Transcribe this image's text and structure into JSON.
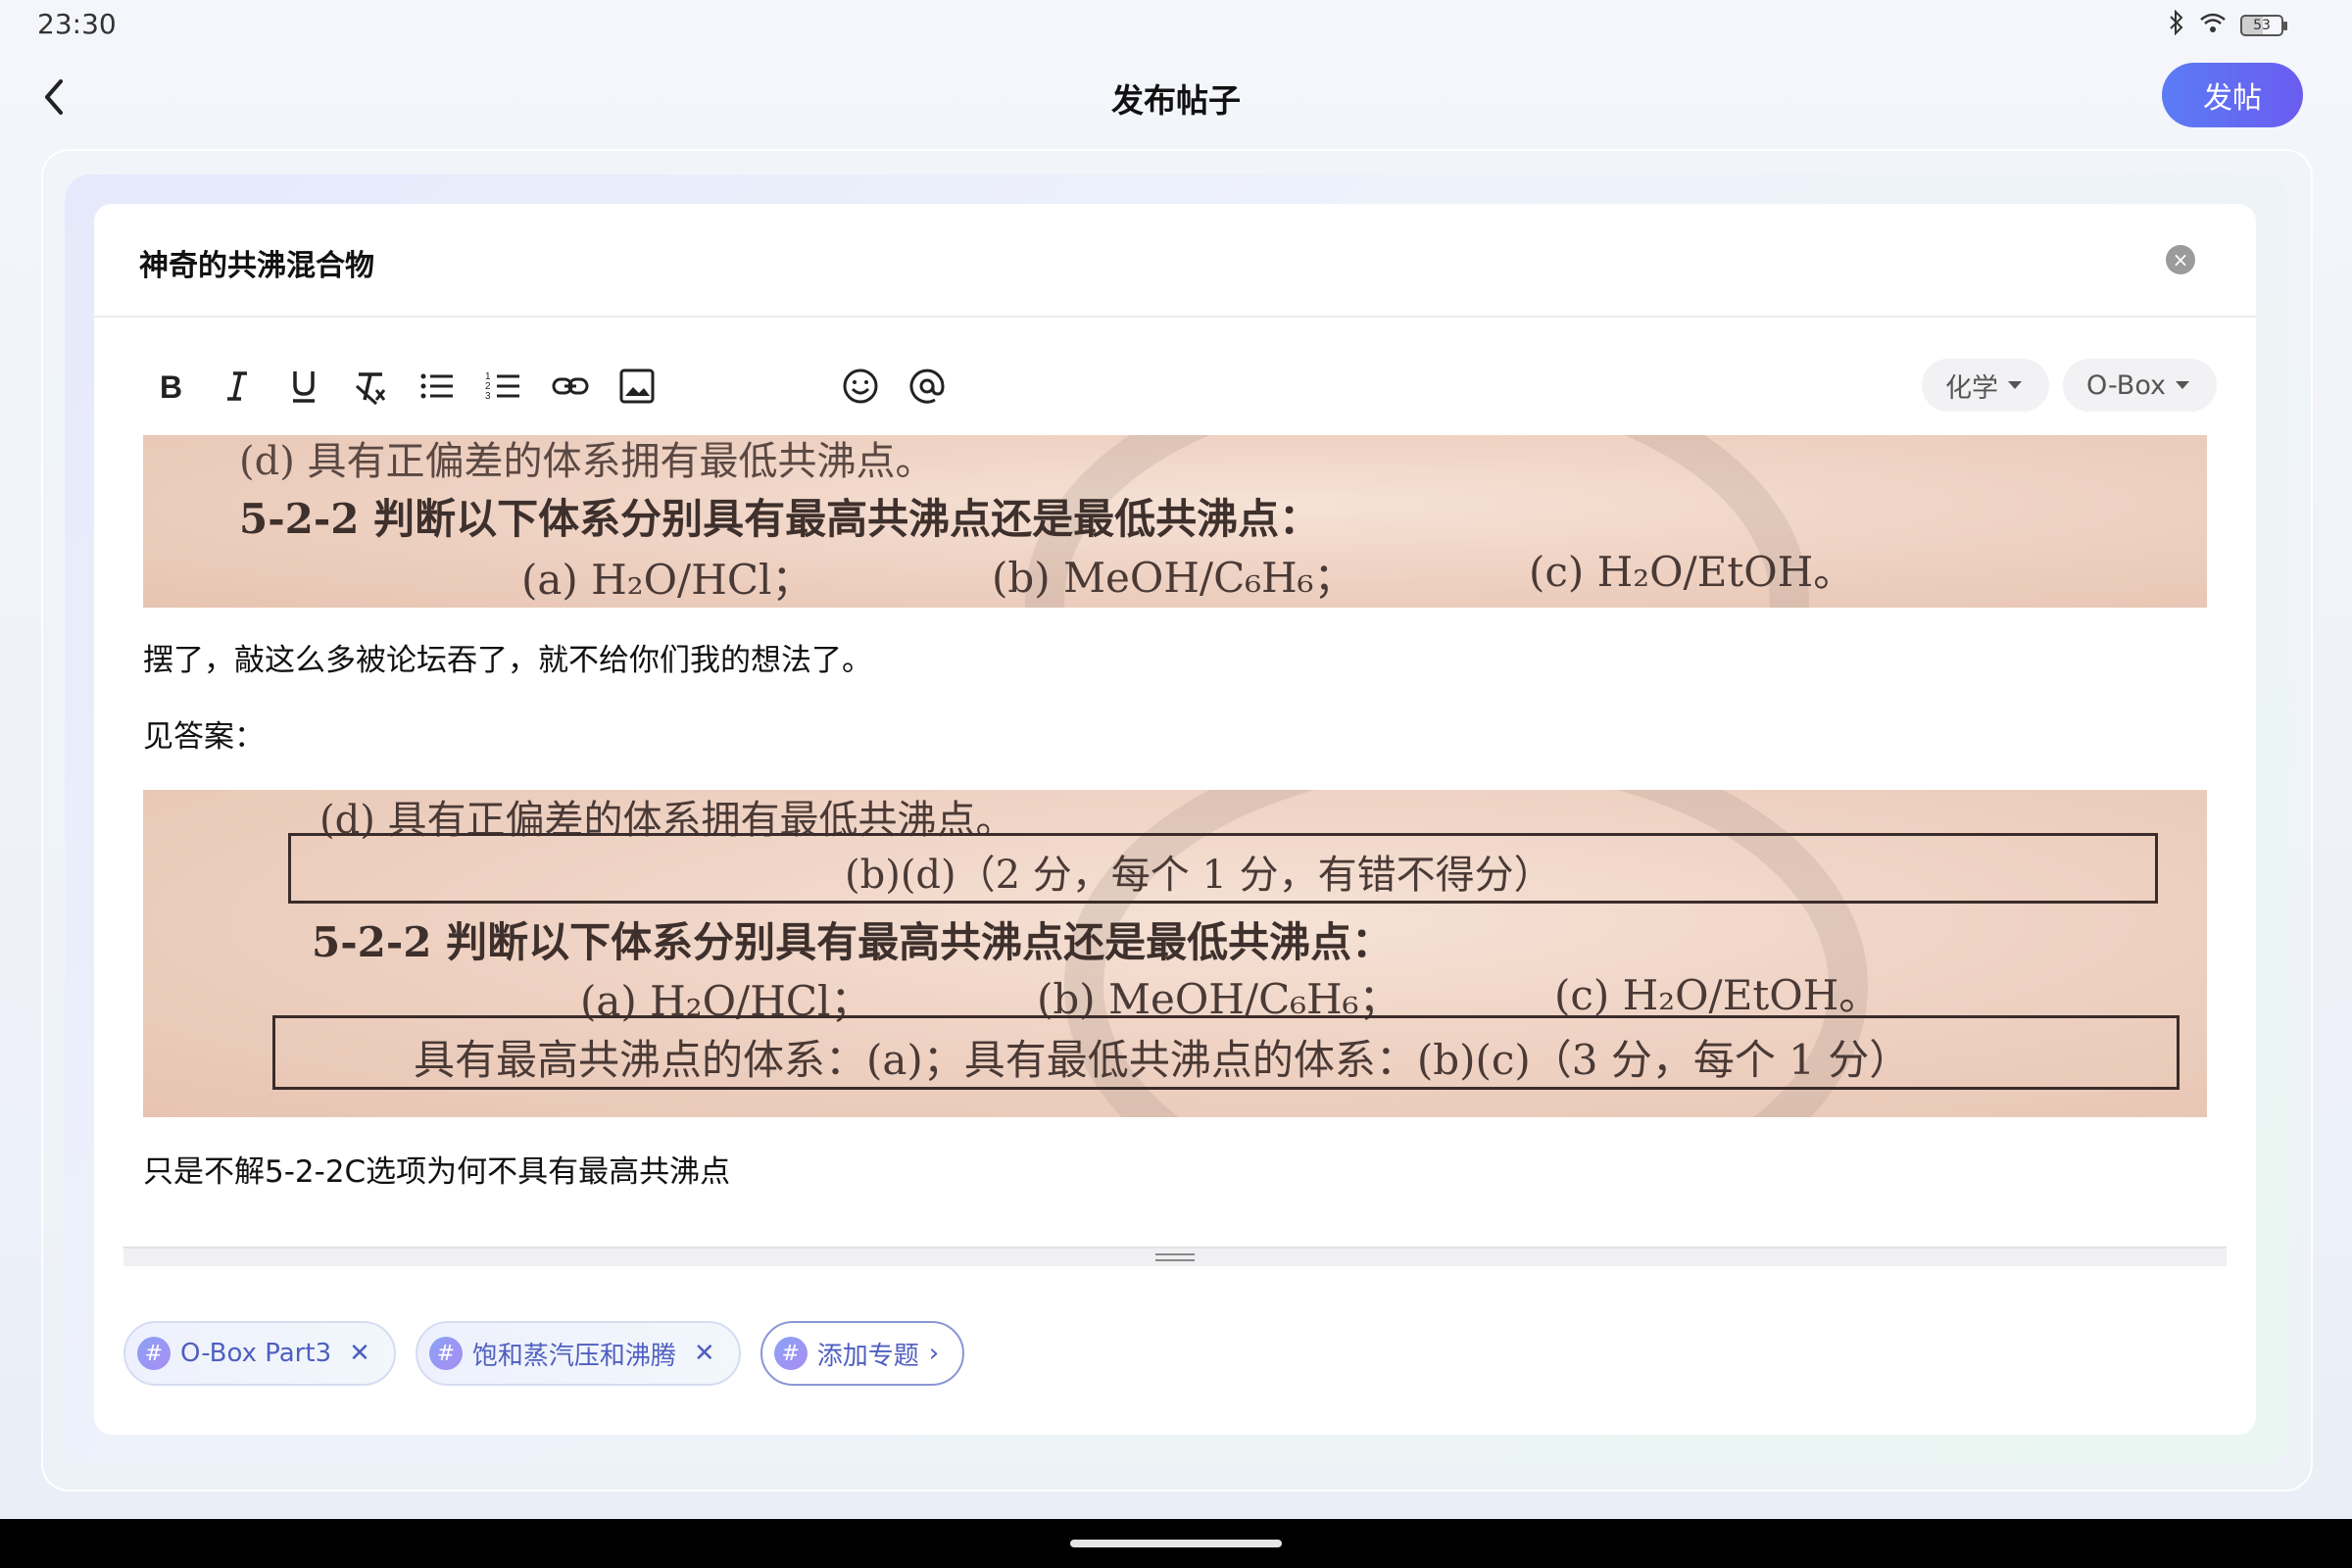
{
  "status_bar": {
    "time": "23:30",
    "battery": "53"
  },
  "header": {
    "title": "发布帖子",
    "publish_label": "发帖"
  },
  "post": {
    "title": "神奇的共沸混合物",
    "toolbar": {
      "tools": [
        "bold-icon",
        "italic-icon",
        "underline-icon",
        "clear-format-icon",
        "bullet-list-icon",
        "numbered-list-icon",
        "link-icon",
        "image-icon",
        "emoji-icon",
        "mention-icon"
      ]
    },
    "category": "化学",
    "board": "O-Box",
    "image1": {
      "line1": "(d)  具有正偏差的体系拥有最低共沸点。",
      "line2": "5-2-2 判断以下体系分别具有最高共沸点还是最低共沸点：",
      "opt_a": "(a)  H₂O/HCl；",
      "opt_b": "(b)  MeOH/C₆H₆；",
      "opt_c": "(c)  H₂O/EtOH。"
    },
    "paragraph1": "摆了，敲这么多被论坛吞了，就不给你们我的想法了。",
    "paragraph2": "见答案：",
    "image2": {
      "line1": "(d)  具有正偏差的体系拥有最低共沸点。",
      "answer1": "(b)(d)（2 分，每个 1 分，有错不得分）",
      "line2": "5-2-2 判断以下体系分别具有最高共沸点还是最低共沸点：",
      "opt_a": "(a)  H₂O/HCl；",
      "opt_b": "(b)  MeOH/C₆H₆；",
      "opt_c": "(c)  H₂O/EtOH。",
      "answer2": "具有最高共沸点的体系：(a)；具有最低共沸点的体系：(b)(c)（3 分，每个 1 分）"
    },
    "paragraph3": "只是不解5-2-2C选项为何不具有最高共沸点"
  },
  "tags": [
    {
      "label": "O-Box Part3",
      "removable": true
    },
    {
      "label": "饱和蒸汽压和沸腾",
      "removable": true
    }
  ],
  "add_topic_label": "添加专题"
}
